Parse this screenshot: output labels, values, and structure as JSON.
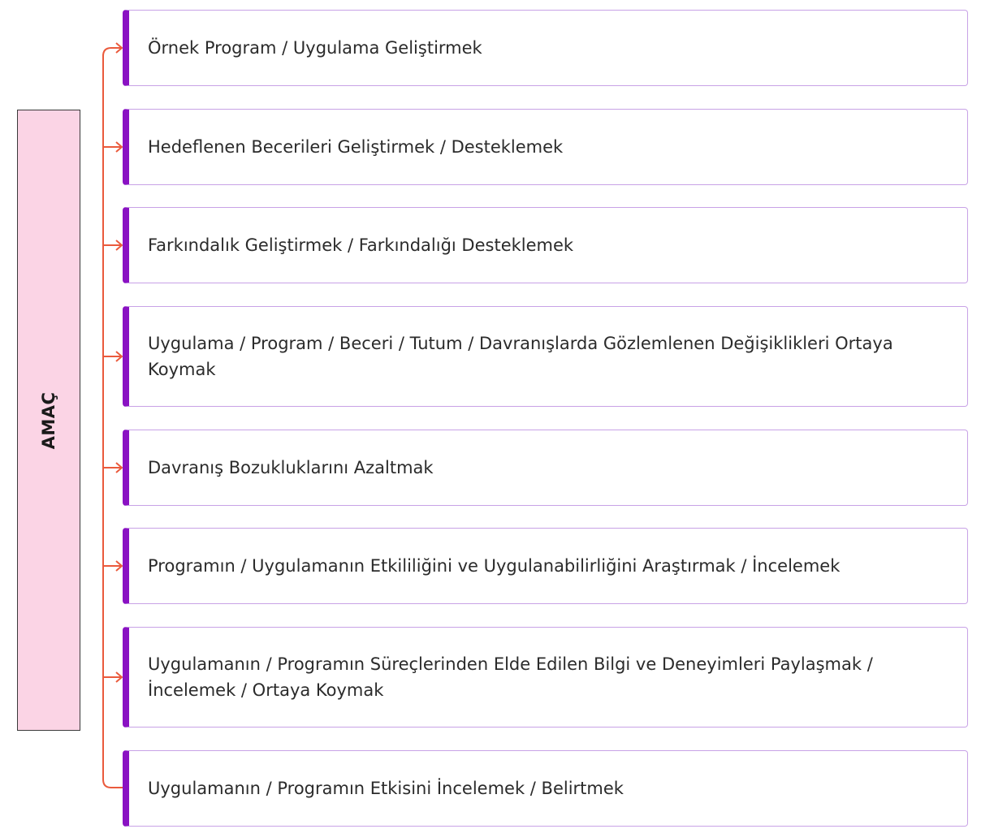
{
  "root": {
    "label": "AMAÇ"
  },
  "items": [
    {
      "label": "Örnek Program / Uygulama Geliştirmek"
    },
    {
      "label": "Hedeflenen Becerileri Geliştirmek / Desteklemek"
    },
    {
      "label": "Farkındalık Geliştirmek / Farkındalığı Desteklemek"
    },
    {
      "label": "Uygulama / Program / Beceri / Tutum / Davranışlarda Gözlemlenen Değişiklikleri Ortaya Koymak"
    },
    {
      "label": "Davranış Bozukluklarını Azaltmak"
    },
    {
      "label": "Programın / Uygulamanın Etkililiğini ve Uygulanabilirliğini Araştırmak / İncelemek"
    },
    {
      "label": "Uygulamanın / Programın Süreçlerinden Elde Edilen Bilgi ve Deneyimleri Paylaşmak / İncelemek / Ortaya Koymak"
    },
    {
      "label": "Uygulamanın / Programın Etkisini İncelemek / Belirtmek"
    }
  ],
  "colors": {
    "root_fill": "#fbd4e5",
    "root_border": "#3a3a3a",
    "item_accent": "#8a12c3",
    "item_border": "#c8a2e6",
    "connector": "#ea5a3c"
  }
}
